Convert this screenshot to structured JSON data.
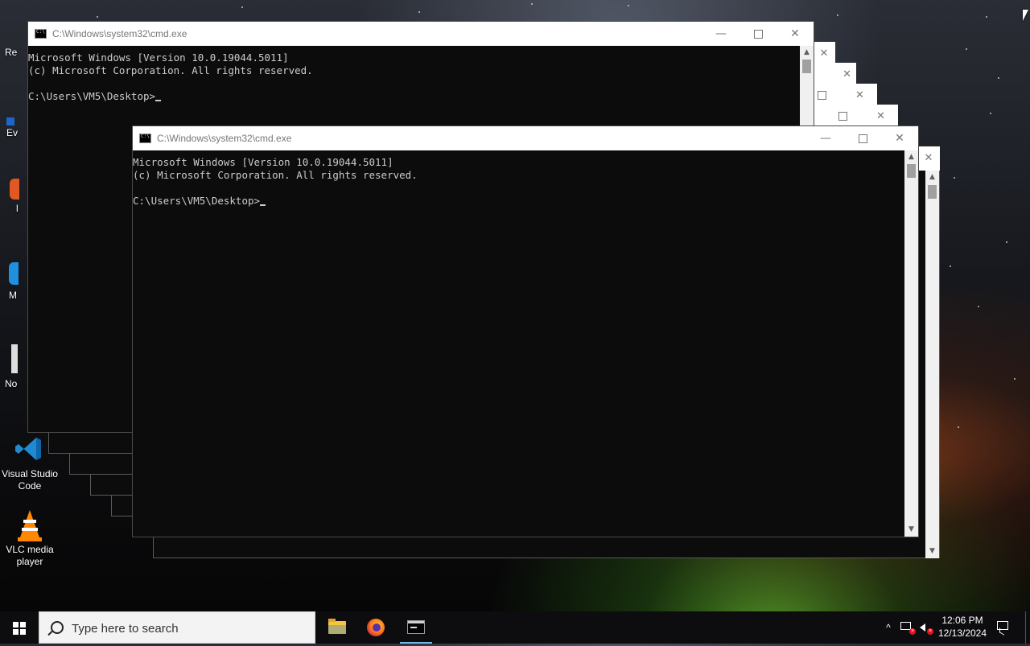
{
  "desktop": {
    "icons": [
      {
        "label": "Visual Studio Code",
        "icon": "vscode-icon"
      },
      {
        "label": "VLC media player",
        "icon": "vlc-icon"
      }
    ],
    "partial_labels": [
      "Re",
      "Ev",
      "l",
      "M",
      "No"
    ]
  },
  "windows": {
    "back": {
      "title": "C:\\Windows\\system32\\cmd.exe",
      "lines": [
        "Microsoft Windows [Version 10.0.19044.5011]",
        "(c) Microsoft Corporation. All rights reserved.",
        "",
        "C:\\Users\\VM5\\Desktop>"
      ]
    },
    "front": {
      "title": "C:\\Windows\\system32\\cmd.exe",
      "lines": [
        "Microsoft Windows [Version 10.0.19044.5011]",
        "(c) Microsoft Corporation. All rights reserved.",
        "",
        "C:\\Users\\VM5\\Desktop>"
      ]
    },
    "controls": {
      "minimize": "—",
      "close": "✕"
    }
  },
  "taskbar": {
    "search_placeholder": "Type here to search",
    "apps": [
      {
        "name": "File Explorer",
        "icon": "file-explorer-icon"
      },
      {
        "name": "Firefox",
        "icon": "firefox-icon"
      },
      {
        "name": "Command Prompt",
        "icon": "cmd-icon",
        "active": true
      }
    ],
    "tray": {
      "chevron": "^",
      "time": "12:06 PM",
      "date": "12/13/2024"
    }
  },
  "colors": {
    "console_bg": "#0c0c0c",
    "console_text": "#cccccc",
    "titlebar_bg": "#ffffff",
    "taskbar_bg": "#0d0d0f",
    "accent": "#76b9ed"
  }
}
